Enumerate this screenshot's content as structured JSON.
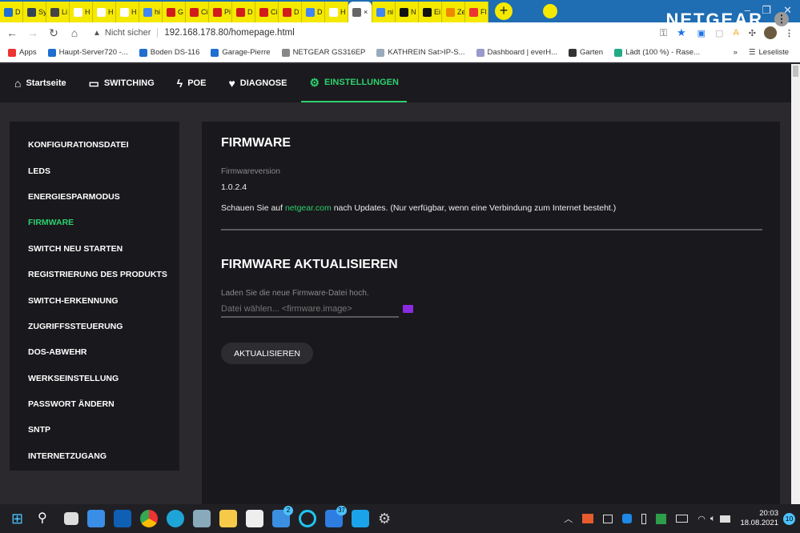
{
  "browser": {
    "tabs": [
      {
        "label": "D",
        "color": "#1e6fd0"
      },
      {
        "label": "Sy",
        "color": "#345"
      },
      {
        "label": "Li",
        "color": "#444"
      },
      {
        "label": "H",
        "color": "#fff"
      },
      {
        "label": "H",
        "color": "#fff"
      },
      {
        "label": "H",
        "color": "#fff"
      },
      {
        "label": "hi",
        "color": "#4285f4"
      },
      {
        "label": "G",
        "color": "#d21c1c"
      },
      {
        "label": "Ci",
        "color": "#d21c1c"
      },
      {
        "label": "Pi",
        "color": "#d21c1c"
      },
      {
        "label": "D",
        "color": "#d21c1c"
      },
      {
        "label": "Ci",
        "color": "#d21c1c"
      },
      {
        "label": "D",
        "color": "#d21c1c"
      },
      {
        "label": "D",
        "color": "#4285f4"
      },
      {
        "label": "H",
        "color": "#fff"
      },
      {
        "label": "×",
        "color": "#666",
        "active": true
      },
      {
        "label": "ni",
        "color": "#4285f4"
      },
      {
        "label": "N",
        "color": "#111"
      },
      {
        "label": "Ei",
        "color": "#111"
      },
      {
        "label": "Ze",
        "color": "#e80"
      },
      {
        "label": "Fl",
        "color": "#e33"
      }
    ],
    "security": "Nicht sicher",
    "url": "192.168.178.80/homepage.html",
    "bookmarks": [
      "Apps",
      "Haupt-Server720 -...",
      "Boden DS-116",
      "Garage-Pierre",
      "NETGEAR GS316EP",
      "KATHREIN Sat>IP-S...",
      "Dashboard | everH...",
      "Garten",
      "Lädt (100 %) - Rase..."
    ],
    "overflow": "»",
    "reading_list": "Leseliste"
  },
  "header": {
    "nav": [
      {
        "label": "Startseite",
        "icon": "home-icon"
      },
      {
        "label": "SWITCHING",
        "icon": "switch-icon"
      },
      {
        "label": "POE",
        "icon": "bolt-icon"
      },
      {
        "label": "DIAGNOSE",
        "icon": "heart-pulse-icon"
      },
      {
        "label": "EINSTELLUNGEN",
        "icon": "gear-icon",
        "active": true
      }
    ],
    "logo": "NETGEAR",
    "accent": "#2ed06e"
  },
  "sidebar": {
    "items": [
      "KONFIGURATIONSDATEI",
      "LEDS",
      "ENERGIESPARMODUS",
      "FIRMWARE",
      "SWITCH NEU STARTEN",
      "REGISTRIERUNG DES PRODUKTS",
      "SWITCH-ERKENNUNG",
      "ZUGRIFFSSTEUERUNG",
      "DOS-ABWEHR",
      "WERKSEINSTELLUNG",
      "PASSWORT ÄNDERN",
      "SNTP",
      "INTERNETZUGANG"
    ],
    "active_index": 3
  },
  "main": {
    "title": "FIRMWARE",
    "version_label": "Firmwareversion",
    "version": "1.0.2.4",
    "info_pre": "Schauen Sie auf ",
    "info_link": "netgear.com",
    "info_post": " nach Updates. (Nur verfügbar, wenn eine Verbindung zum Internet besteht.)",
    "update_title": "FIRMWARE AKTUALISIEREN",
    "upload_label": "Laden Sie die neue Firmware-Datei hoch.",
    "file_placeholder": "Datei wählen... <firmware.image>",
    "update_button": "AKTUALISIEREN"
  },
  "taskbar": {
    "mail_badge": "2",
    "todo_badge": "37",
    "time": "20:03",
    "date": "18.08.2021",
    "notifications": "10"
  }
}
